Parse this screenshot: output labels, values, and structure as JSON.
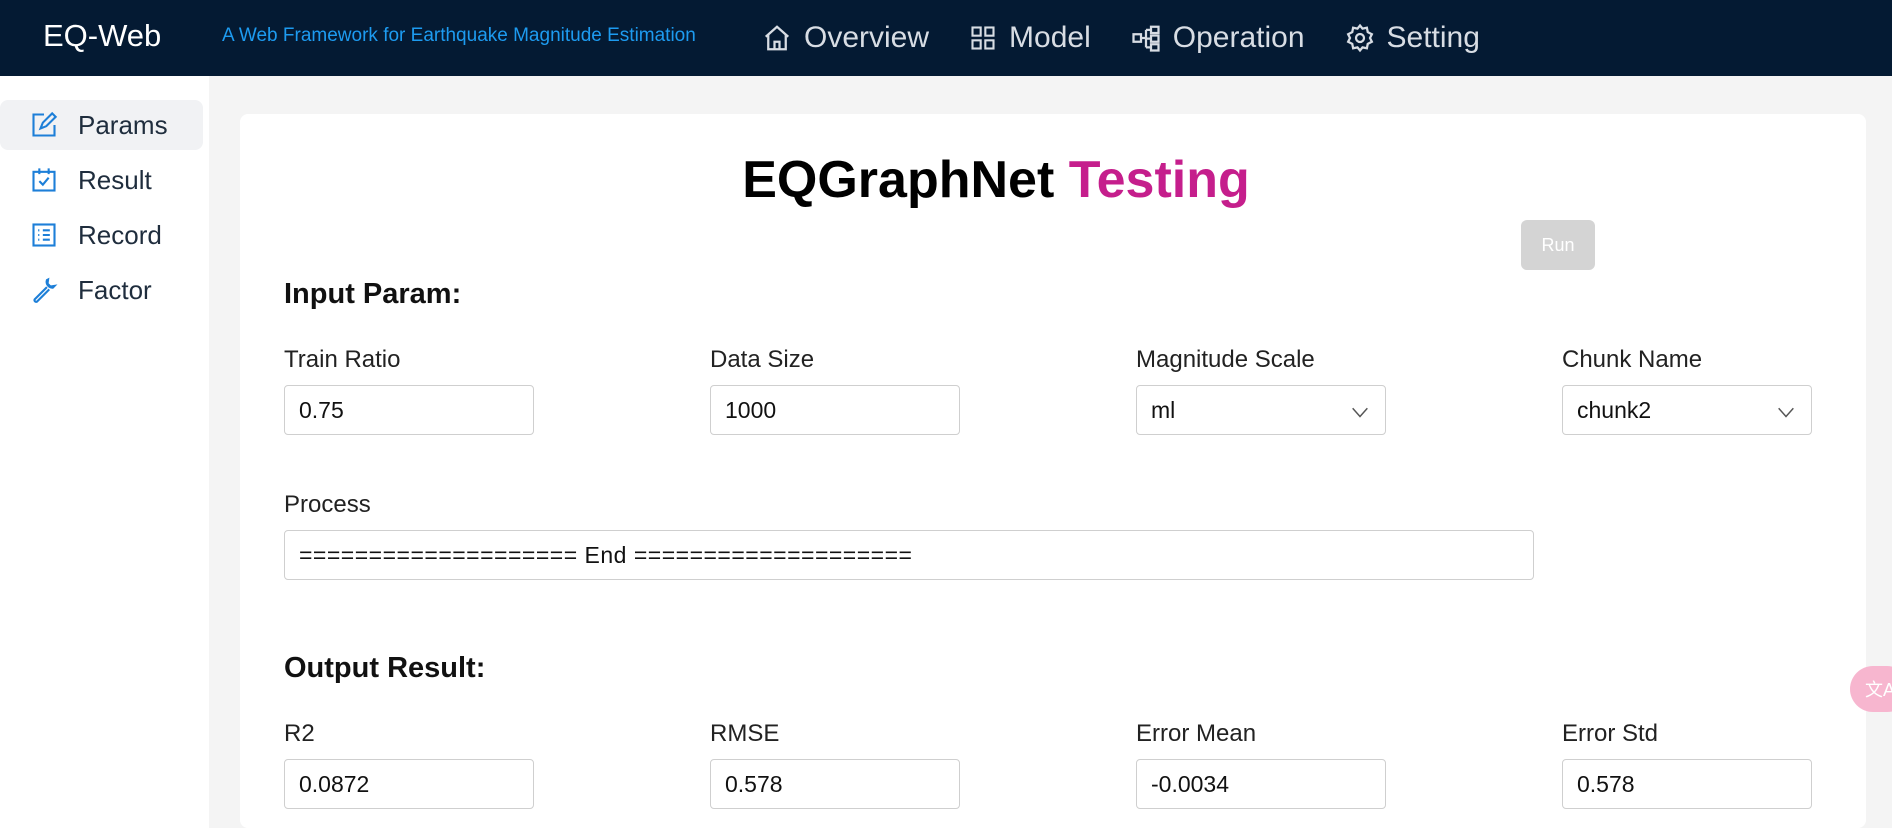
{
  "header": {
    "brand": "EQ-Web",
    "tagline": "A Web Framework for Earthquake Magnitude Estimation",
    "nav": [
      {
        "label": "Overview",
        "icon": "home-icon"
      },
      {
        "label": "Model",
        "icon": "grid-icon"
      },
      {
        "label": "Operation",
        "icon": "flow-icon"
      },
      {
        "label": "Setting",
        "icon": "gear-icon"
      }
    ]
  },
  "sidebar": {
    "items": [
      {
        "label": "Params",
        "icon": "edit-icon",
        "active": true
      },
      {
        "label": "Result",
        "icon": "calendar-check-icon"
      },
      {
        "label": "Record",
        "icon": "list-icon"
      },
      {
        "label": "Factor",
        "icon": "wrench-icon"
      }
    ]
  },
  "main": {
    "title_main": "EQGraphNet",
    "title_accent": "Testing",
    "run_label": "Run",
    "input_section": "Input Param:",
    "inputs": {
      "train_ratio": {
        "label": "Train Ratio",
        "value": "0.75"
      },
      "data_size": {
        "label": "Data Size",
        "value": "1000"
      },
      "magnitude_scale": {
        "label": "Magnitude Scale",
        "value": "ml"
      },
      "chunk_name": {
        "label": "Chunk Name",
        "value": "chunk2"
      }
    },
    "process": {
      "label": "Process",
      "value": "====================  End  ===================="
    },
    "output_section": "Output Result:",
    "outputs": {
      "r2": {
        "label": "R2",
        "value": "0.0872"
      },
      "rmse": {
        "label": "RMSE",
        "value": "0.578"
      },
      "error_mean": {
        "label": "Error Mean",
        "value": "-0.0034"
      },
      "error_std": {
        "label": "Error Std",
        "value": "0.578"
      }
    }
  },
  "colors": {
    "header_bg": "#041a33",
    "tagline": "#1d9bf0",
    "accent": "#c51e8c",
    "icon": "#1d7fd8"
  },
  "float_button": {
    "label": "文A",
    "icon": "translate-icon"
  }
}
